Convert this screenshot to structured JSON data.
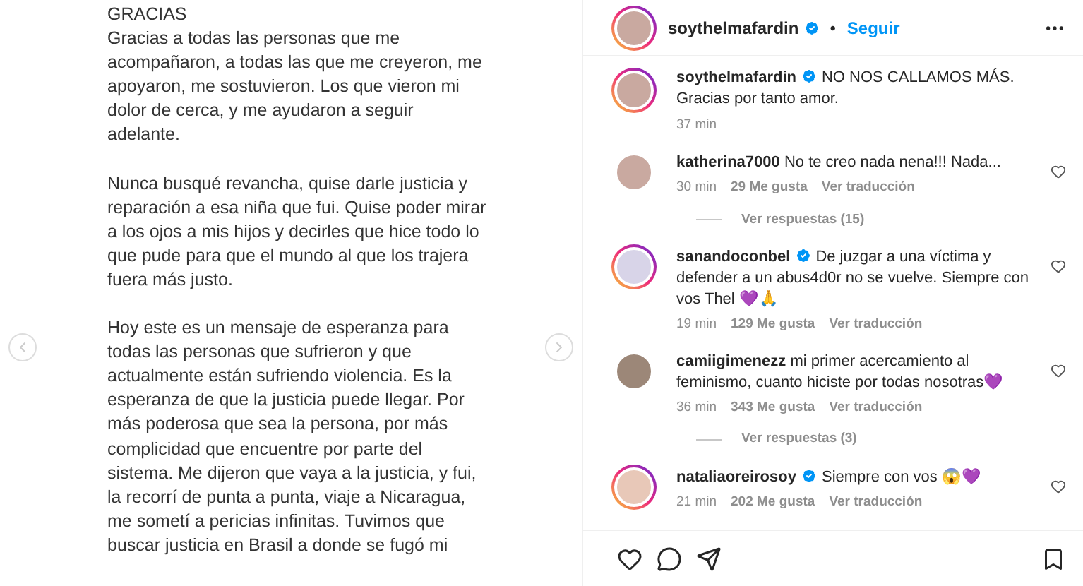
{
  "post_text": [
    "GRACIAS\nGracias a todas las personas que me\nacompañaron, a todas las que me creyeron, me\napoyaron, me sostuvieron. Los que vieron mi\ndolor de cerca, y me ayudaron a seguir\nadelante.",
    "Nunca busqué revancha, quise darle justicia y\nreparación a esa niña que fui. Quise poder mirar\na los ojos a mis hijos y decirles que hice todo lo\nque pude para que el mundo al que los trajera\nfuera más justo.",
    "Hoy este es un mensaje de esperanza para\ntodas las personas que sufrieron y que\nactualmente están sufriendo violencia. Es la\nesperanza de que la justicia puede llegar. Por\nmás poderosa que sea la persona, por más\ncomplicidad que encuentre por parte del\nsistema. Me dijeron que vaya a la justicia, y fui,\nla recorrí de punta a punta, viaje a Nicaragua,\nme sometí a pericias infinitas. Tuvimos que\nbuscar justicia en Brasil a donde se fugó mi"
  ],
  "header": {
    "username": "soythelmafardin",
    "verified": true,
    "separator": "•",
    "follow": "Seguir"
  },
  "caption": {
    "username": "soythelmafardin",
    "verified": true,
    "text": "NO NOS CALLAMOS MÁS. Gracias por tanto amor.",
    "time": "37 min"
  },
  "comments": [
    {
      "username": "katherina7000",
      "verified": false,
      "text": "No te creo nada nena!!! Nada...",
      "time": "30 min",
      "likes": "29 Me gusta",
      "translate": "Ver traducción",
      "replies": "Ver respuestas (15)",
      "avatar_ring": false
    },
    {
      "username": "sanandoconbel",
      "verified": true,
      "text": "De juzgar a una víctima y defender a un abus4d0r no se vuelve. Siempre con vos Thel 💜🙏",
      "time": "19 min",
      "likes": "129 Me gusta",
      "translate": "Ver traducción",
      "avatar_ring": true
    },
    {
      "username": "camiigimenezz",
      "verified": false,
      "text": "mi primer acercamiento al feminismo, cuanto hiciste por todas nosotras💜",
      "time": "36 min",
      "likes": "343 Me gusta",
      "translate": "Ver traducción",
      "replies": "Ver respuestas (3)",
      "avatar_ring": false
    },
    {
      "username": "nataliaoreirosoy",
      "verified": true,
      "text": "Siempre con vos 😱💜",
      "time": "21 min",
      "likes": "202 Me gusta",
      "translate": "Ver traducción",
      "avatar_ring": true
    }
  ]
}
